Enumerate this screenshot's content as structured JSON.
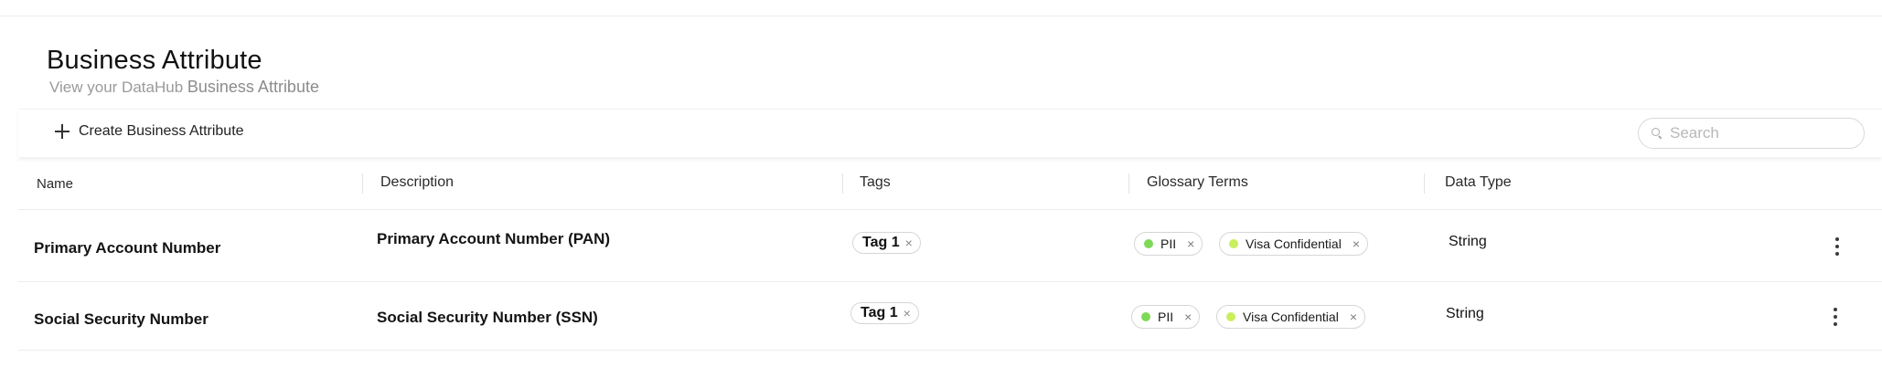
{
  "page": {
    "title": "Business Attribute",
    "subtitle_prefix": "View your DataHub",
    "subtitle_strong": "Business Attribute"
  },
  "toolbar": {
    "create_label": "Create Business Attribute",
    "create_icon": "plus-icon",
    "search_placeholder": "Search",
    "search_icon": "search-icon"
  },
  "table": {
    "columns": [
      "Name",
      "Description",
      "Tags",
      "Glossary Terms",
      "Data Type"
    ],
    "rows": [
      {
        "name": "Primary Account Number",
        "description": "Primary Account Number (PAN)",
        "tags": [
          "Tag 1"
        ],
        "terms": [
          {
            "label": "PII",
            "color": "#7ed957"
          },
          {
            "label": "Visa Confidential",
            "color": "#c9ef5c"
          }
        ],
        "data_type": "String"
      },
      {
        "name": "Social Security Number",
        "description": "Social Security Number (SSN)",
        "tags": [
          "Tag 1"
        ],
        "terms": [
          {
            "label": "PII",
            "color": "#7ed957"
          },
          {
            "label": "Visa Confidential",
            "color": "#c9ef5c"
          }
        ],
        "data_type": "String"
      }
    ],
    "remove_glyph": "×",
    "row_menu_icon": "more-vertical-icon"
  }
}
